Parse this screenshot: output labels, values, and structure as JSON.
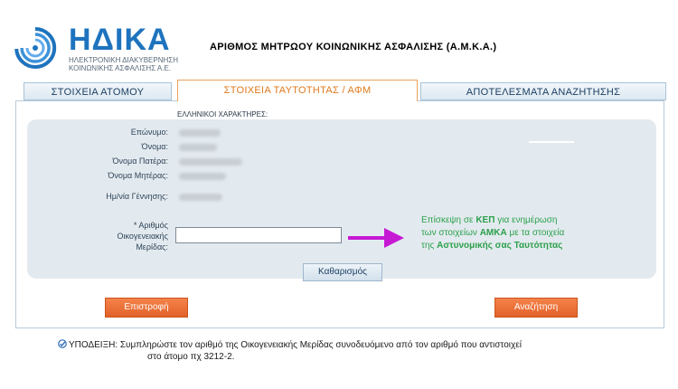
{
  "brand": {
    "name": "ΗΔΙΚΑ",
    "subtitle_line1": "ΗΛΕΚΤΡΟΝΙΚΗ ΔΙΑΚΥΒΕΡΝΗΣΗ",
    "subtitle_line2": "ΚΟΙΝΩΝΙΚΗΣ ΑΣΦΑΛΙΣΗΣ Α.Ε.",
    "color": "#1e73be"
  },
  "page_title": "ΑΡΙΘΜΟΣ ΜΗΤΡΩΟΥ ΚΟΙΝΩΝΙΚΗΣ ΑΣΦΑΛΙΣΗΣ (Α.Μ.Κ.Α.)",
  "tabs": [
    {
      "label": "ΣΤΟΙΧΕΙΑ ΑΤΟΜΟΥ",
      "active": false
    },
    {
      "label": "ΣΤΟΙΧΕΙΑ ΤΑΥΤΟΤΗΤΑΣ / ΑΦΜ",
      "active": true
    },
    {
      "label": "ΑΠΟΤΕΛΕΣΜΑΤΑ ΑΝΑΖΗΤΗΣΗΣ",
      "active": false
    }
  ],
  "form": {
    "section_label": "ΕΛΛΗΝΙΚΟΙ ΧΑΡΑΚΤΗΡΕΣ:",
    "fields": {
      "surname": "Επώνυμο:",
      "name": "Όνομα:",
      "father_name": "Όνομα Πατέρα:",
      "mother_name": "Όνομα Μητέρας:",
      "birth_date": "Ημ/νία Γέννησης:"
    },
    "family_share": {
      "label_line1": "* Αριθμός",
      "label_line2": "Οικογενειακής",
      "label_line3": "Μερίδας:",
      "value": ""
    }
  },
  "note": {
    "part1": "Επίσκεψη σε ",
    "kep": "ΚΕΠ",
    "part2": " για  ενημέρωση",
    "part3": "των στοιχείων ",
    "amka": "ΑΜΚΑ",
    "part4": " με τα στοιχεία",
    "part5": "της ",
    "police_id": "Αστυνομικής σας Ταυτότητας",
    "color": "#2ca04c"
  },
  "buttons": {
    "clear": "Καθαρισμός",
    "back": "Επιστροφή",
    "search": "Αναζήτηση"
  },
  "hint": {
    "line1": "ΥΠΟΔΕΙΞΗ: Συμπληρώστε τον αριθμό της Οικογενειακής Μερίδας συνοδευόμενο από τον αριθμό που αντιστοιχεί",
    "line2": "στο άτομο πχ 3212-2."
  },
  "colors": {
    "accent_orange": "#e2622a",
    "arrow_magenta": "#c619d4",
    "tab_border": "#a9c3d8"
  }
}
